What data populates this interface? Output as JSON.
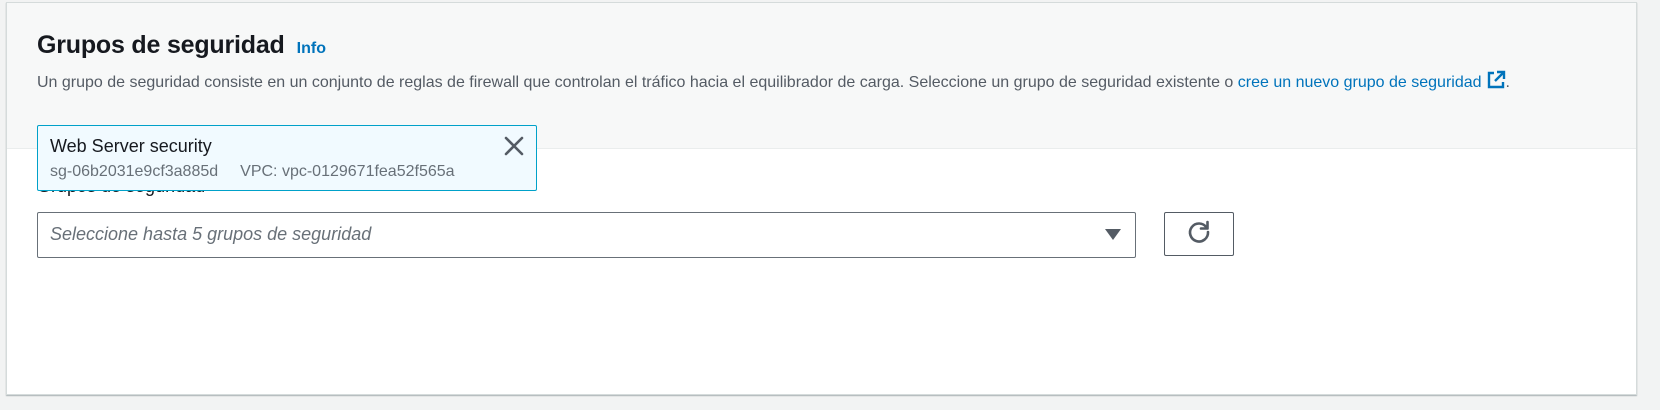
{
  "section": {
    "title": "Grupos de seguridad",
    "info_label": "Info",
    "description_text": "Un grupo de seguridad consiste en un conjunto de reglas de firewall que controlan el tráfico hacia el equilibrador de carga. Seleccione un grupo de seguridad existente o ",
    "description_link": "cree un nuevo grupo de seguridad",
    "description_end": "."
  },
  "field": {
    "label": "Grupos de seguridad",
    "placeholder": "Seleccione hasta 5 grupos de seguridad"
  },
  "selected_groups": [
    {
      "name": "Web Server security",
      "id": "sg-06b2031e9cf3a885d",
      "vpc": "VPC: vpc-0129671fea52f565a"
    }
  ],
  "icons": {
    "external": "external-link-icon",
    "caret": "caret-down-icon",
    "refresh": "refresh-icon",
    "dismiss": "close-icon"
  },
  "colors": {
    "link": "#0073bb",
    "token_border": "#00a1c9",
    "token_bg": "#f1faff"
  }
}
